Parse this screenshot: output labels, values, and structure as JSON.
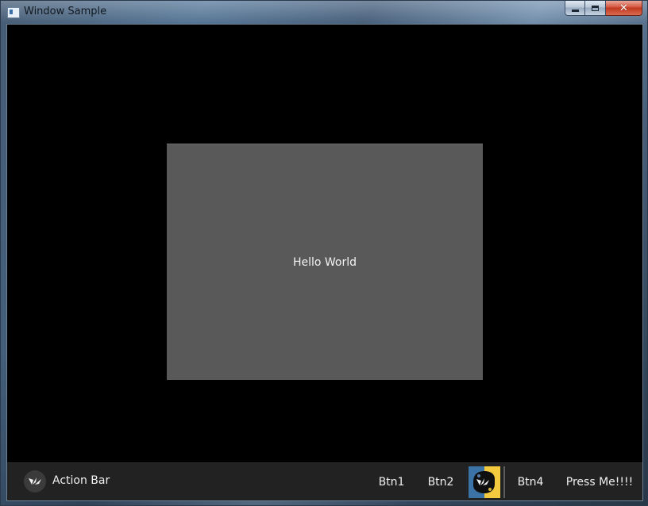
{
  "window": {
    "title": "Window Sample",
    "icon": "app-window-icon",
    "controls": {
      "minimize": "minimize-icon",
      "maximize": "maximize-icon",
      "close_glyph": "✕"
    }
  },
  "content": {
    "label": "Hello World"
  },
  "action_bar": {
    "title": "Action Bar",
    "logo": "kivy-logo-icon",
    "buttons": [
      {
        "label": "Btn1"
      },
      {
        "label": "Btn2"
      },
      {
        "icon": "python-kivy-logo-icon"
      },
      {
        "label": "Btn4"
      },
      {
        "label": "Press Me!!!!"
      }
    ]
  },
  "colors": {
    "client_background": "#000000",
    "panel": "#595959",
    "action_bar": "#222222",
    "text": "#f0f0f0"
  }
}
